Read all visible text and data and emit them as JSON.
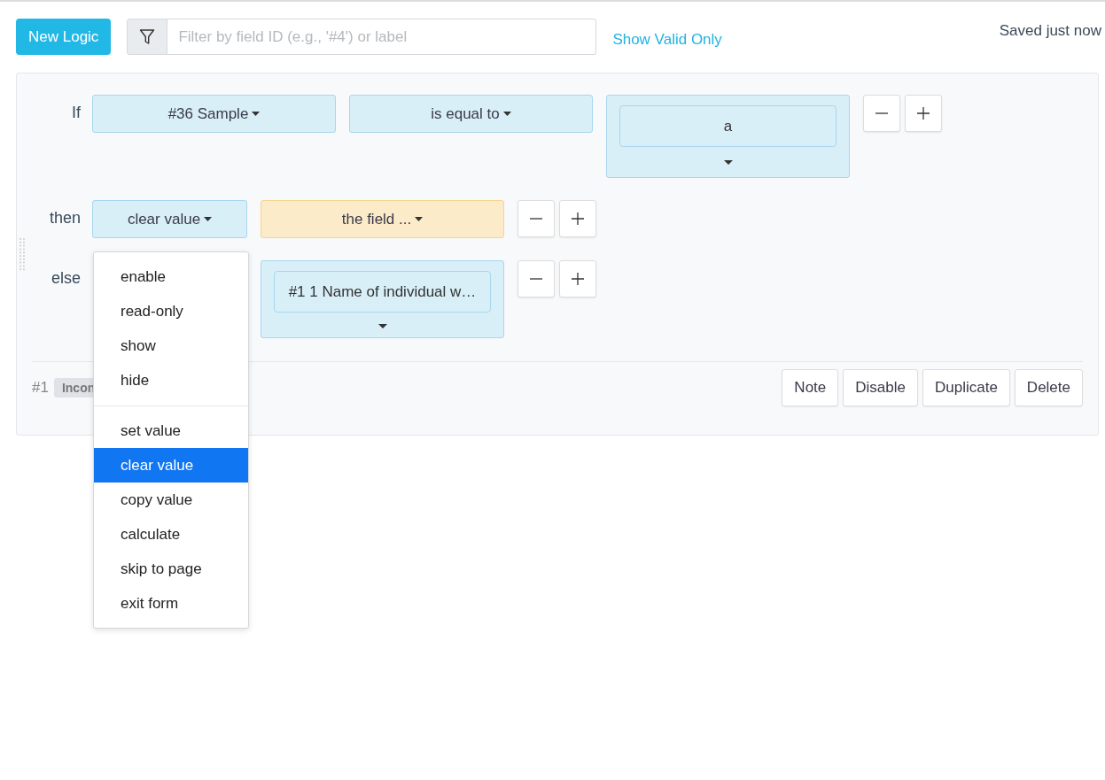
{
  "toolbar": {
    "new_button": "New Logic",
    "filter": {
      "placeholder": "Filter by field ID (e.g., '#4') or label"
    },
    "valid_link": "Show Valid Only",
    "status": "Saved just now"
  },
  "rule": {
    "rows": [
      {
        "label": "If",
        "fields": [
          {
            "kind": "select",
            "color": "#d9eff8",
            "text": "#36 Sample"
          },
          {
            "kind": "select",
            "color": "#d9eff8",
            "text": "is equal to"
          },
          {
            "kind": "multi",
            "color": "#d9eff8",
            "text": "a"
          }
        ]
      },
      {
        "label": "then",
        "fields": [
          {
            "kind": "select",
            "color": "#d9eff8",
            "text": "clear value"
          },
          {
            "kind": "select",
            "color": "#fcebc8",
            "text": "the field ..."
          }
        ]
      },
      {
        "label": "else",
        "fields": [
          {
            "kind": "covered"
          },
          {
            "kind": "multi",
            "color": "#d9eff8",
            "text": "#1 1 Name of individual w…"
          }
        ]
      }
    ],
    "number": "#1",
    "badge": "Incon",
    "actions": [
      "Note",
      "Disable",
      "Duplicate",
      "Delete"
    ]
  },
  "menu": {
    "groups": [
      [
        {
          "label": "enable",
          "selected": false
        },
        {
          "label": "read-only",
          "selected": false
        },
        {
          "label": "show",
          "selected": false
        },
        {
          "label": "hide",
          "selected": false
        }
      ],
      [
        {
          "label": "set value",
          "selected": false
        },
        {
          "label": "clear value",
          "selected": true
        },
        {
          "label": "copy value",
          "selected": false
        },
        {
          "label": "calculate",
          "selected": false
        },
        {
          "label": "skip to page",
          "selected": false
        },
        {
          "label": "exit form",
          "selected": false
        }
      ]
    ]
  }
}
